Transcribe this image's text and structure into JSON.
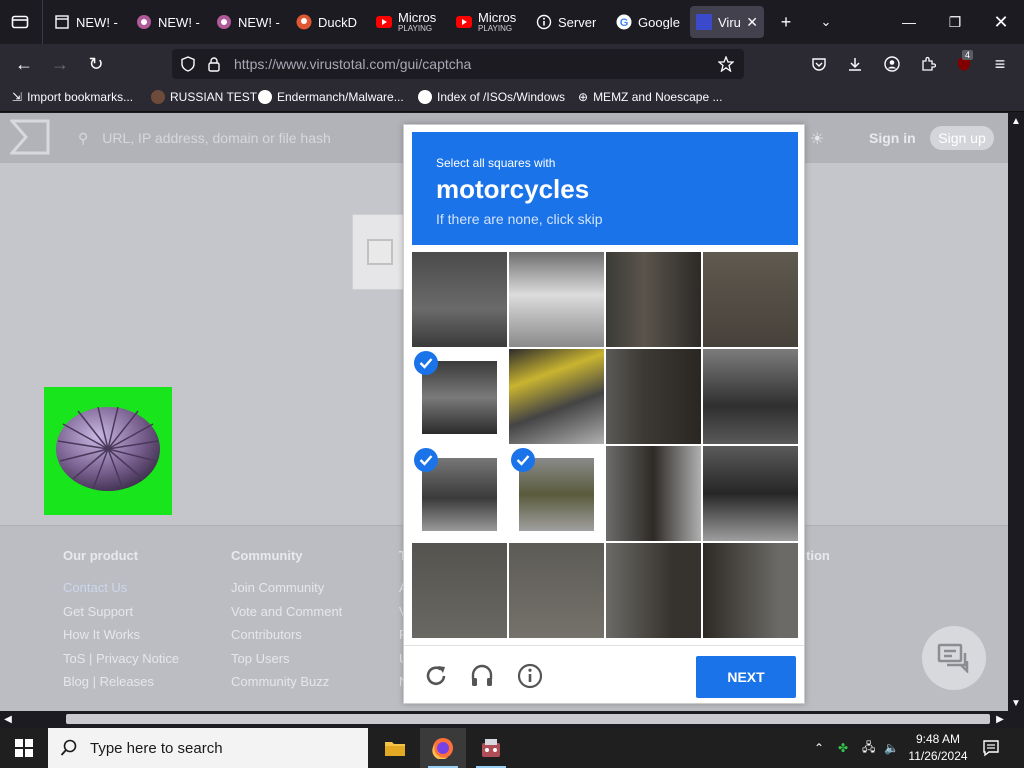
{
  "browser": {
    "tabs": [
      {
        "label": "NEW! - Bor",
        "sub": ""
      },
      {
        "label": "NEW! -",
        "sub": ""
      },
      {
        "label": "NEW! -",
        "sub": ""
      },
      {
        "label": "DuckD",
        "sub": ""
      },
      {
        "label": "Micros",
        "sub": "PLAYING"
      },
      {
        "label": "Micros",
        "sub": "PLAYING"
      },
      {
        "label": "Server",
        "sub": ""
      },
      {
        "label": "Google",
        "sub": ""
      },
      {
        "label": "Viru",
        "sub": ""
      }
    ],
    "url": "https://www.virustotal.com/gui/captcha",
    "extension_badge": "4",
    "bookmarks": [
      "Import bookmarks...",
      "RUSSIAN TEST",
      "Endermanch/Malware...",
      "Index of /ISOs/Windows",
      "MEMZ and Noescape ..."
    ]
  },
  "site": {
    "search_placeholder": "URL, IP address, domain or file hash",
    "sign_in": "Sign in",
    "sign_up": "Sign up",
    "footer": [
      {
        "heading": "Our product",
        "links": [
          "Contact Us",
          "Get Support",
          "How It Works",
          "ToS | Privacy Notice",
          "Blog | Releases"
        ]
      },
      {
        "heading": "Community",
        "links": [
          "Join Community",
          "Vote and Comment",
          "Contributors",
          "Top Users",
          "Community Buzz"
        ]
      }
    ],
    "footer_partial_letters": [
      "T",
      "A",
      "V",
      "F",
      "U",
      "N"
    ],
    "footer_partial_heading": "tion"
  },
  "captcha": {
    "instruction": "Select all squares with",
    "target": "motorcycles",
    "hint": "If there are none, click skip",
    "selected_tiles": [
      4,
      8,
      9
    ],
    "next_label": "NEXT"
  },
  "taskbar": {
    "search_placeholder": "Type here to search",
    "time": "9:48 AM",
    "date": "11/26/2024"
  }
}
